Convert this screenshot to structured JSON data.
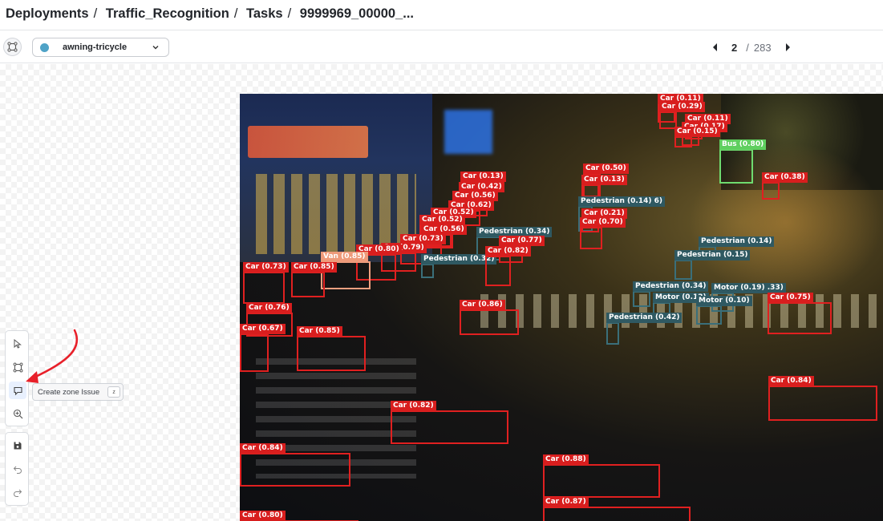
{
  "breadcrumb": {
    "items": [
      "Deployments",
      "Traffic_Recognition",
      "Tasks",
      "9999969_00000_..."
    ],
    "separator": "/"
  },
  "toolbar": {
    "label_select": {
      "value": "awning-tricycle",
      "dot_color": "#4fa3c7",
      "icon": "chevron-down-icon"
    },
    "pager": {
      "current": "2",
      "separator": "/",
      "total": "283"
    }
  },
  "tooltip": {
    "text": "Create zone Issue",
    "shortcut": "z"
  },
  "side_tools": [
    {
      "name": "select-tool",
      "icon": "cursor-icon"
    },
    {
      "name": "bbox-tool",
      "icon": "bounding-box-icon"
    },
    {
      "name": "zone-issue-tool",
      "icon": "comment-icon",
      "active": true
    },
    {
      "name": "zoom-tool",
      "icon": "zoom-icon"
    }
  ],
  "side_tools_2": [
    {
      "name": "save-button",
      "icon": "save-icon"
    },
    {
      "name": "undo-button",
      "icon": "undo-icon"
    },
    {
      "name": "redo-button",
      "icon": "redo-icon"
    }
  ],
  "colors": {
    "car": "#e02020",
    "pedestrian": "#2f5962",
    "bus": "#5fcf5f",
    "van": "#ee9a7a",
    "annotation_arrow": "#e8202a"
  },
  "detections": [
    {
      "label": "Car (0.11)",
      "cls": "car"
    },
    {
      "label": "Car (0.29)",
      "cls": "car"
    },
    {
      "label": "Car (0.11)",
      "cls": "car"
    },
    {
      "label": "Car (0.17)",
      "cls": "car"
    },
    {
      "label": "Car (0.15)",
      "cls": "car"
    },
    {
      "label": "Bus (0.80)",
      "cls": "bus"
    },
    {
      "label": "Car (0.38)",
      "cls": "car"
    },
    {
      "label": "Car (0.50)",
      "cls": "car"
    },
    {
      "label": "Car (0.13)",
      "cls": "car"
    },
    {
      "label": "Pedestrian (0.14) 6)",
      "cls": "ped"
    },
    {
      "label": "Car (0.21)",
      "cls": "car"
    },
    {
      "label": "Car (0.70)",
      "cls": "car"
    },
    {
      "label": "Car (0.13)",
      "cls": "car"
    },
    {
      "label": "Car (0.42)",
      "cls": "car"
    },
    {
      "label": "Car (0.56)",
      "cls": "car"
    },
    {
      "label": "Car (0.62)",
      "cls": "car"
    },
    {
      "label": "Car (0.52)",
      "cls": "car"
    },
    {
      "label": "Car (0.52)",
      "cls": "car"
    },
    {
      "label": "Car (0.56)",
      "cls": "car"
    },
    {
      "label": "Pedestrian (0.34)",
      "cls": "ped"
    },
    {
      "label": "Car (0.73)",
      "cls": "car"
    },
    {
      "label": "Car (0.77)",
      "cls": "car"
    },
    {
      "label": "Car (0.79)",
      "cls": "car"
    },
    {
      "label": "Car (0.80)",
      "cls": "car"
    },
    {
      "label": "Pedestrian (0.32)",
      "cls": "ped"
    },
    {
      "label": "Car (0.82)",
      "cls": "car"
    },
    {
      "label": "Van (0.85)",
      "cls": "van"
    },
    {
      "label": "Car (0.73)",
      "cls": "car"
    },
    {
      "label": "Car (0.85)",
      "cls": "car"
    },
    {
      "label": "Pedestrian (0.14)",
      "cls": "ped"
    },
    {
      "label": "Pedestrian (0.15)",
      "cls": "ped"
    },
    {
      "label": "Pedestrian (0.34)",
      "cls": "ped"
    },
    {
      "label": "Motor (0.12)",
      "cls": "ped"
    },
    {
      "label": "Motor (0.19) .33)",
      "cls": "ped"
    },
    {
      "label": "Motor (0.10)",
      "cls": "ped"
    },
    {
      "label": "Car (0.75)",
      "cls": "car"
    },
    {
      "label": "Car (0.76)",
      "cls": "car"
    },
    {
      "label": "Car (0.86)",
      "cls": "car"
    },
    {
      "label": "Pedestrian (0.42)",
      "cls": "ped"
    },
    {
      "label": "Car (0.67)",
      "cls": "car"
    },
    {
      "label": "Car (0.85)",
      "cls": "car"
    },
    {
      "label": "Car (0.84)",
      "cls": "car"
    },
    {
      "label": "Car (0.82)",
      "cls": "car"
    },
    {
      "label": "Car (0.84)",
      "cls": "car"
    },
    {
      "label": "Car (0.88)",
      "cls": "car"
    },
    {
      "label": "Car (0.87)",
      "cls": "car"
    },
    {
      "label": "Car (0.80)",
      "cls": "car"
    }
  ]
}
